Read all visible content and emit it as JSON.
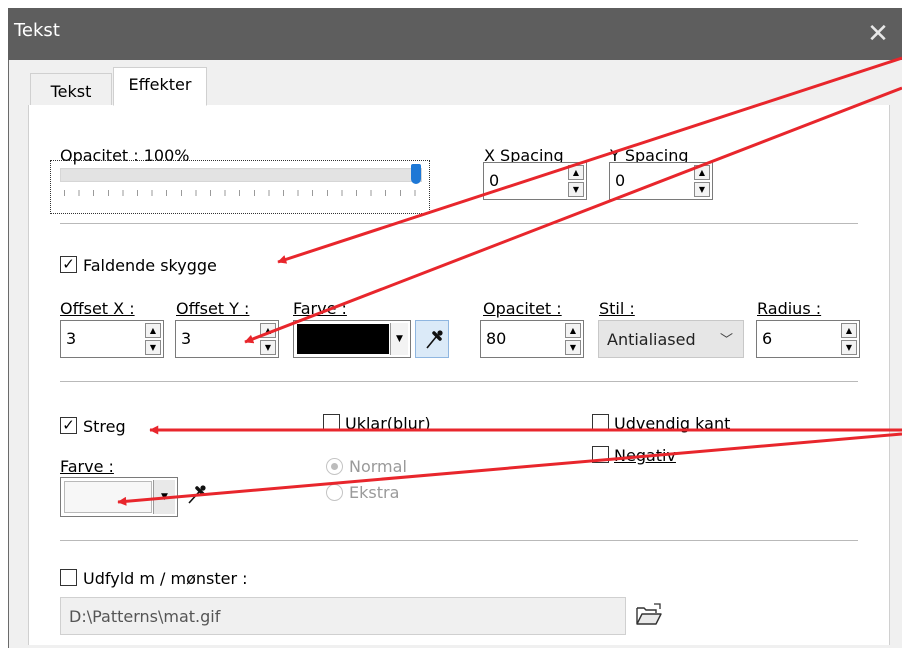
{
  "window": {
    "title": "Tekst",
    "close_glyph": "✕",
    "tabs": [
      {
        "label": "Tekst",
        "active": false
      },
      {
        "label": "Effekter",
        "active": true
      }
    ]
  },
  "opacity": {
    "label": "Opacitet : 100%",
    "value_percent": 100
  },
  "spacing": {
    "x_label": "X Spacing",
    "x_value": "0",
    "y_label": "Y Spacing",
    "y_value": "0"
  },
  "drop_shadow": {
    "label": "Faldende skygge",
    "checked": true,
    "check_glyph": "✓",
    "offset_x_label": "Offset X :",
    "offset_x_value": "3",
    "offset_y_label": "Offset Y :",
    "offset_y_value": "3",
    "color_label": "Farve :",
    "color_value": "#000000",
    "opacity_label": "Opacitet :",
    "opacity_value": "80",
    "style_label": "Stil :",
    "style_value": "Antialiased",
    "radius_label": "Radius :",
    "radius_value": "6"
  },
  "stroke": {
    "label": "Streg",
    "checked": true,
    "check_glyph": "✓",
    "blur_label": "Uklar(blur)",
    "blur_checked": false,
    "outer_edge_label": "Udvendig kant",
    "outer_edge_checked": false,
    "negative_label": "Negativ",
    "negative_checked": false,
    "color_label": "Farve :",
    "mode_options": [
      {
        "label": "Normal",
        "selected": true
      },
      {
        "label": "Ekstra",
        "selected": false
      }
    ]
  },
  "fill_pattern": {
    "label": "Udfyld m / mønster :",
    "checked": false,
    "path_value": "D:\\Patterns\\mat.gif"
  },
  "icons": {
    "eyedropper": "eyedropper-icon",
    "folder_open": "folder-open-icon",
    "spin_up": "▲",
    "spin_down": "▼",
    "combo_down": "▼",
    "chevron_down": "﹀"
  },
  "colors": {
    "annotation_arrow": "#e8262c",
    "slider_thumb": "#1e78d6",
    "titlebar": "#5e5e5e"
  }
}
